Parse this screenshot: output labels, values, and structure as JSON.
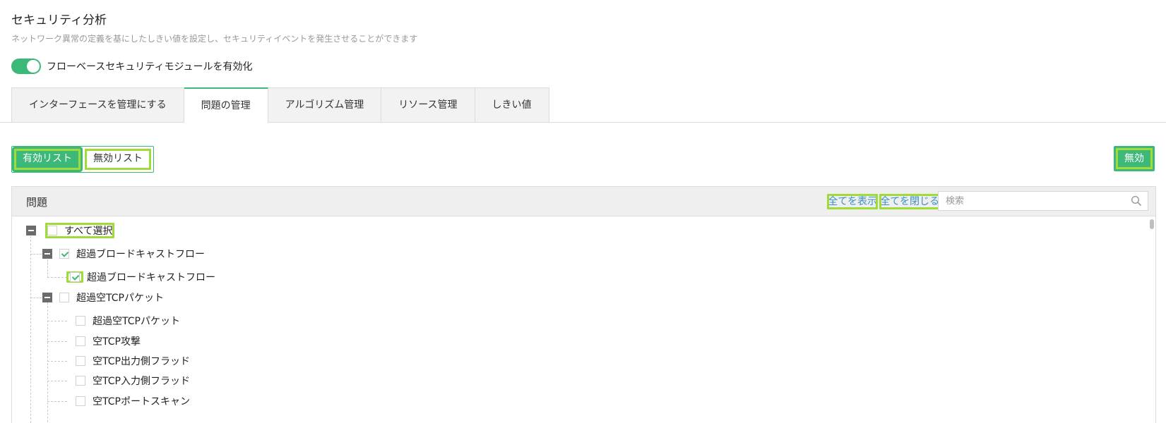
{
  "header": {
    "title": "セキュリティ分析",
    "subtitle": "ネットワーク異常の定義を基にしたしきい値を設定し、セキュリティイベントを発生させることができます"
  },
  "module_toggle": {
    "label": "フローベースセキュリティモジュールを有効化",
    "enabled": true
  },
  "tabs": [
    {
      "label": "インターフェースを管理にする",
      "active": false
    },
    {
      "label": "問題の管理",
      "active": true
    },
    {
      "label": "アルゴリズム管理",
      "active": false
    },
    {
      "label": "リソース管理",
      "active": false
    },
    {
      "label": "しきい値",
      "active": false
    }
  ],
  "list_switch": {
    "enabled_label": "有効リスト",
    "disabled_label": "無効リスト",
    "selected": "有効リスト"
  },
  "disable_button": {
    "label": "無効"
  },
  "panel": {
    "title": "問題",
    "show_all": "全てを表示",
    "close_all": "全てを閉じる",
    "search_placeholder": "検索"
  },
  "tree": {
    "select_all": "すべて選択",
    "groups": [
      {
        "label": "超過ブロードキャストフロー",
        "checked": true,
        "children": [
          {
            "label": "超過ブロードキャストフロー",
            "checked": true
          }
        ]
      },
      {
        "label": "超過空TCPパケット",
        "checked": false,
        "children": [
          {
            "label": "超過空TCPパケット",
            "checked": false
          },
          {
            "label": "空TCP攻撃",
            "checked": false
          },
          {
            "label": "空TCP出力側フラッド",
            "checked": false
          },
          {
            "label": "空TCP入力側フラッド",
            "checked": false
          },
          {
            "label": "空TCPポートスキャン",
            "checked": false
          }
        ]
      }
    ]
  },
  "colors": {
    "accent": "#3cb878",
    "link": "#3a8fc9",
    "highlight": "#9fdc3a"
  },
  "icons": {
    "search": "search-icon",
    "collapse": "minus-icon",
    "check": "check-icon"
  }
}
